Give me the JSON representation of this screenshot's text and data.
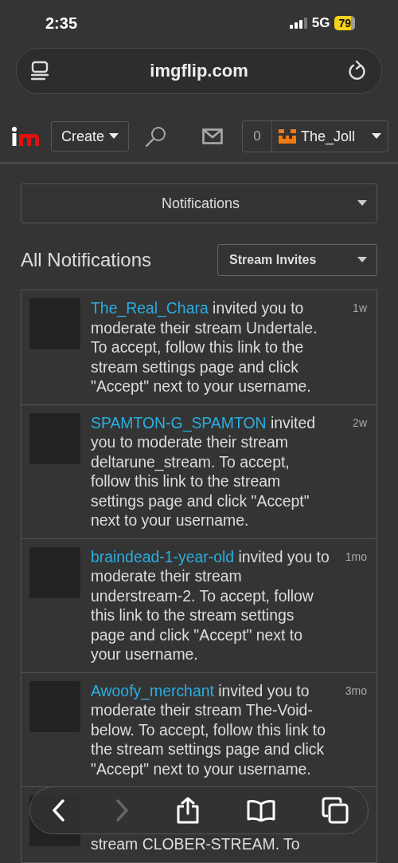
{
  "status_bar": {
    "time": "2:35",
    "network": "5G",
    "battery": "79"
  },
  "address_bar": {
    "url": "imgflip.com"
  },
  "nav": {
    "create": "Create",
    "count": "0",
    "username": "The_Joll"
  },
  "filter_dropdown": {
    "value": "Notifications"
  },
  "heading": "All Notifications",
  "type_dropdown": {
    "value": "Stream Invites"
  },
  "notifications": [
    {
      "user": "The_Real_Chara",
      "message": "invited you to moderate their stream Undertale. To accept, follow this link to the stream settings page and click \"Accept\" next to your username.",
      "time": "1w"
    },
    {
      "user": "SPAMTON-G_SPAMTON",
      "message": "invited you to moderate their stream deltarune_stream. To accept, follow this link to the stream settings page and click \"Accept\" next to your username.",
      "time": "2w"
    },
    {
      "user": "braindead-1-year-old",
      "message": "invited you to moderate their stream understream-2. To accept, follow this link to the stream settings page and click \"Accept\" next to your username.",
      "time": "1mo"
    },
    {
      "user": "Awoofy_merchant",
      "message": "invited you to moderate their stream The-Void-below. To accept, follow this link to the stream settings page and click \"Accept\" next to your username.",
      "time": "3mo"
    },
    {
      "tail": "stream CLOBER-STREAM. To"
    }
  ],
  "toolbar": [
    {
      "kind": "back",
      "disabled": false
    },
    {
      "kind": "forward",
      "disabled": true
    },
    {
      "kind": "share",
      "disabled": false
    },
    {
      "kind": "bookmarks",
      "disabled": false
    },
    {
      "kind": "tabs",
      "disabled": false
    }
  ]
}
